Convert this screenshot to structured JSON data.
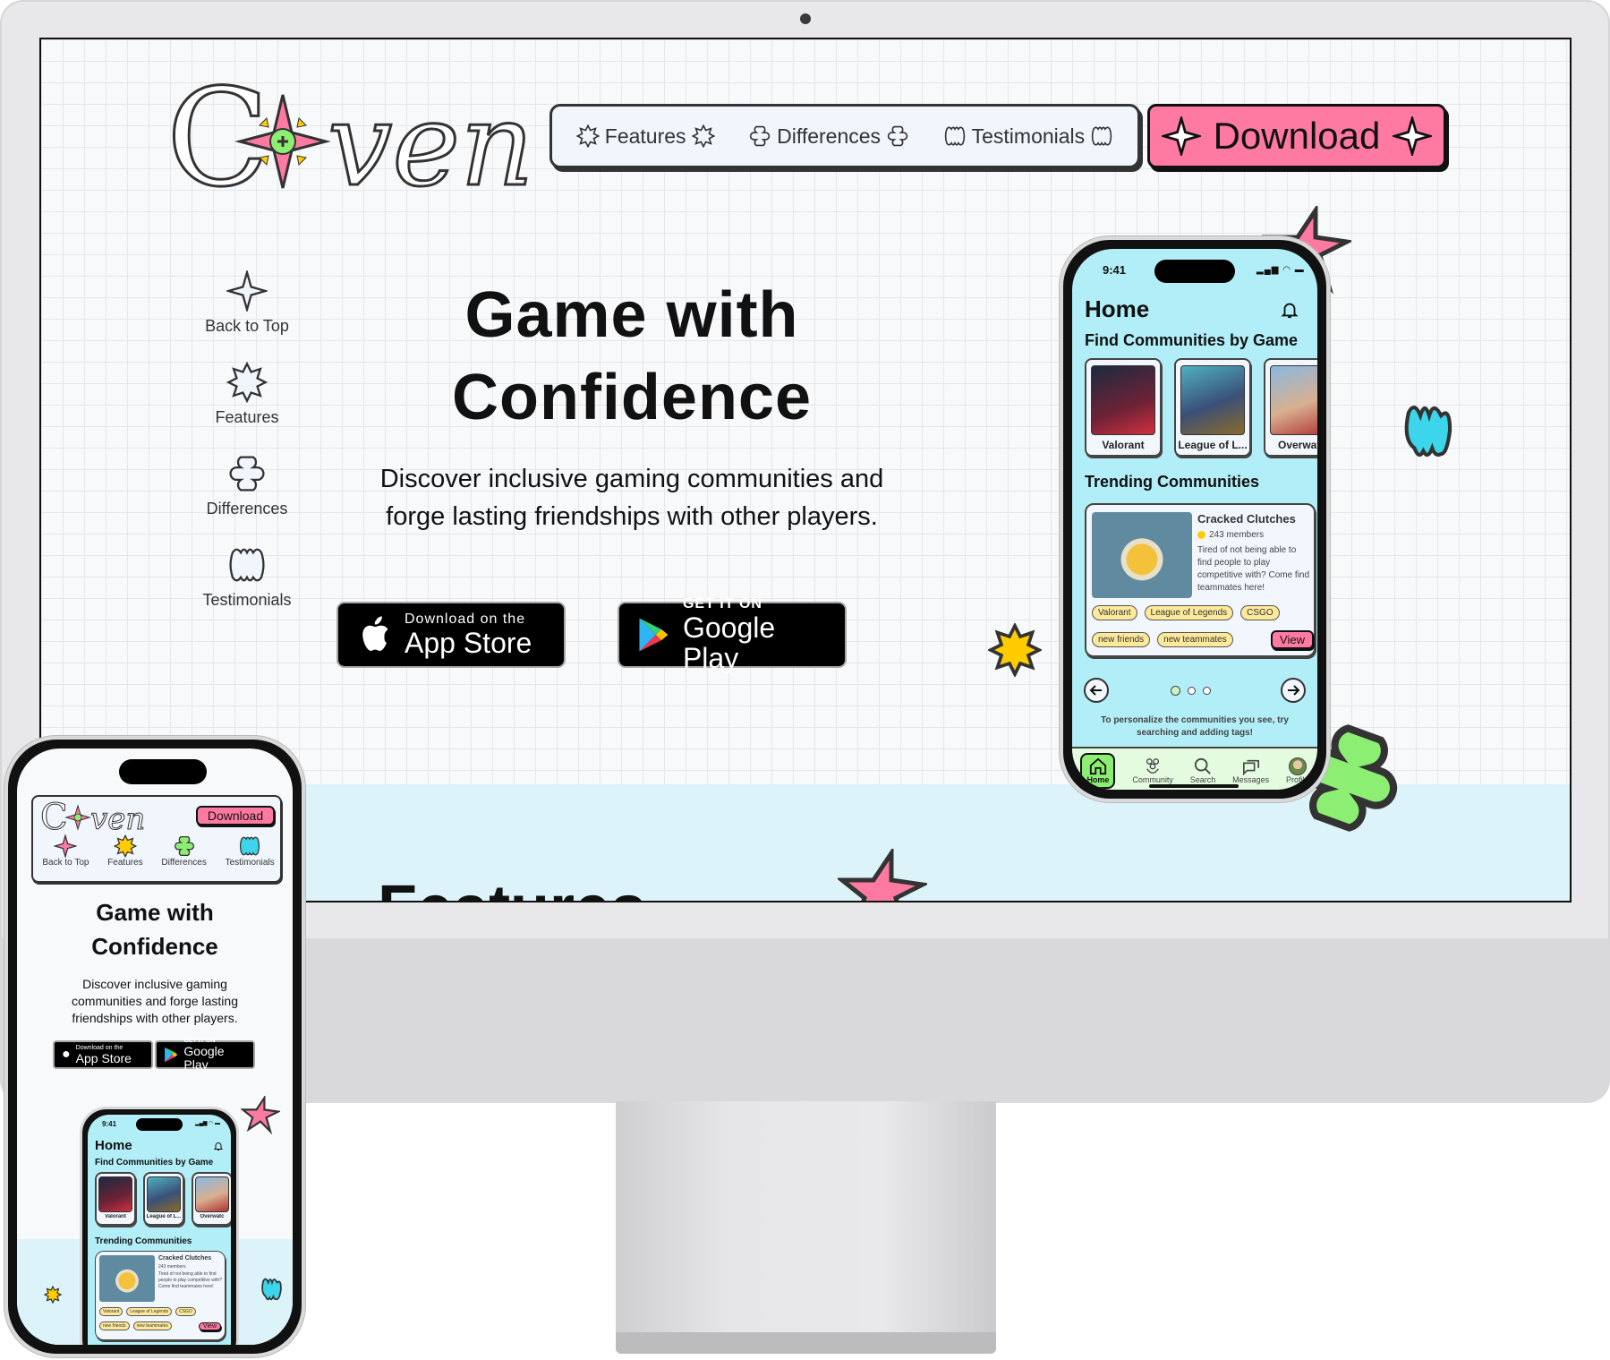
{
  "colors": {
    "accent_pink": "#ff7aa2",
    "accent_yellow": "#ffcc00",
    "accent_green": "#8cee72",
    "accent_cyan": "#3dd5ec",
    "app_bg": "#b2eef8",
    "nav_bg": "#f1f6fd",
    "tag_bg": "#fde99a"
  },
  "site": {
    "logo_text": "Coven",
    "nav": [
      {
        "label": "Features",
        "icon": "burst-star-icon"
      },
      {
        "label": "Differences",
        "icon": "clover-cross-icon"
      },
      {
        "label": "Testimonials",
        "icon": "wavy-blob-icon"
      }
    ],
    "download_label": "Download",
    "side_nav": [
      {
        "label": "Back to Top",
        "icon": "sparkle-star-icon"
      },
      {
        "label": "Features",
        "icon": "burst-star-icon"
      },
      {
        "label": "Differences",
        "icon": "clover-cross-icon"
      },
      {
        "label": "Testimonials",
        "icon": "wavy-blob-icon"
      }
    ],
    "hero": {
      "title_line1": "Game with",
      "title_line2": "Confidence",
      "subtitle_line1": "Discover inclusive gaming communities and",
      "subtitle_line2": "forge lasting friendships with other players."
    },
    "app_store": {
      "small": "Download on the",
      "big": "App Store"
    },
    "google_play": {
      "small": "GET IT ON",
      "big": "Google Play"
    },
    "next_section_heading": "Features"
  },
  "mobile_site": {
    "download_label": "Download",
    "nav": [
      "Back to Top",
      "Features",
      "Differences",
      "Testimonials"
    ],
    "title_line1": "Game with",
    "title_line2": "Confidence",
    "subtitle_line1": "Discover inclusive gaming",
    "subtitle_line2": "communities and forge lasting",
    "subtitle_line3": "friendships with other players.",
    "app_store": {
      "small": "Download on the",
      "big": "App Store"
    },
    "google_play": {
      "small": "GET IT ON",
      "big": "Google Play"
    }
  },
  "app": {
    "status_time": "9:41",
    "screen_title": "Home",
    "games_heading": "Find Communities by Game",
    "games": [
      "Valorant",
      "League of L...",
      "Overwatc"
    ],
    "trending_heading": "Trending Communities",
    "community": {
      "name": "Cracked Clutches",
      "members": "243 members",
      "description": "Tired of not being able to find people to play competitive with? Come find teammates here!",
      "tags": [
        "Valorant",
        "League of Legends",
        "CSGO",
        "new friends",
        "new teammates"
      ],
      "view_label": "View"
    },
    "carousel": {
      "pages": 3,
      "active_page": 1
    },
    "hint": "To personalize the communities you see, try searching and adding tags!",
    "tabs": [
      {
        "label": "Home",
        "active": true
      },
      {
        "label": "Community",
        "active": false
      },
      {
        "label": "Search",
        "active": false
      },
      {
        "label": "Messages",
        "active": false
      },
      {
        "label": "Profile",
        "active": false
      }
    ]
  }
}
